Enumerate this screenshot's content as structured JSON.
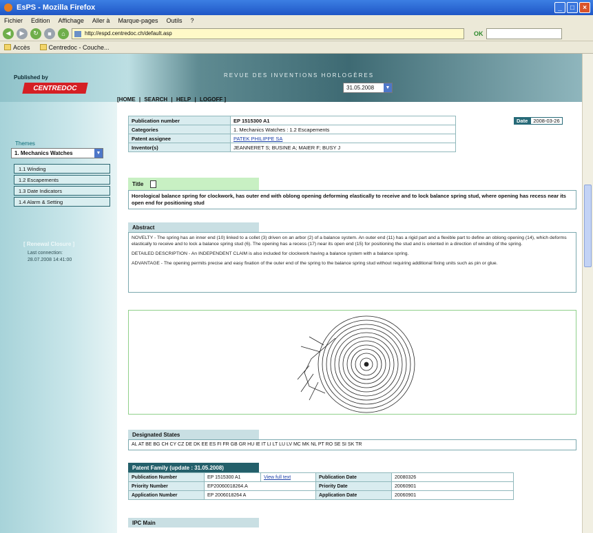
{
  "window": {
    "title": "EsPS - Mozilla Firefox",
    "menu": [
      "Fichier",
      "Edition",
      "Affichage",
      "Aller à",
      "Marque-pages",
      "Outils",
      "?"
    ],
    "url": "http://espd.centredoc.ch/default.asp",
    "bookmarks": [
      "Accès",
      "Centredoc - Couche..."
    ],
    "go_label": "OK"
  },
  "header": {
    "published_by": "Published by",
    "logo_text": "CENTREDOC",
    "review_title": "REVUE DES INVENTIONS HORLOGÈRES",
    "date_value": "31.05.2008",
    "nav": [
      "[HOME",
      "|",
      "SEARCH",
      "|",
      "HELP",
      "|",
      "LOGOFF ]"
    ]
  },
  "sidebar": {
    "theme_label": "Themes",
    "theme_value": "1. Mechanics Watches",
    "submenu": [
      "1.1 Winding",
      "1.2 Escapements",
      "1.3 Date Indicators",
      "1.4 Alarm & Setting"
    ],
    "recent_title": "[ Renewal Closure ]",
    "recent_sub": "Last connection:",
    "recent_date": "28.07.2008 14:41:00"
  },
  "record": {
    "rows": [
      {
        "key": "Publication number",
        "value": "EP 1515300 A1",
        "link": false
      },
      {
        "key": "Categories",
        "value": "1. Mechanics Watches : 1.2 Escapements",
        "link": false
      },
      {
        "key": "Patent assignee",
        "value": "PATEK PHILIPPE SA",
        "link": true
      },
      {
        "key": "Inventor(s)",
        "value": "JEANNERET S; BUSINE A; MAIER F; BUSY J",
        "link": false
      }
    ],
    "date_label": "Date",
    "date_value": "2008-03-26",
    "title_label": "Title",
    "title_text": "Horological balance spring for clockwork, has outer end with oblong opening deforming elastically to receive and to lock balance spring stud, where opening has recess near its open end for positioning stud",
    "abstract_label": "Abstract",
    "abstract": [
      "NOVELTY - The spring has an inner end (10) linked to a collet (3) driven on an arbor (2) of a balance system. An outer end (11) has a rigid part and a flexible part to define an oblong opening (14), which deforms elastically to receive and to lock a balance spring stud (6). The opening has a recess (17) near its open end (15) for positioning the stud and is oriented in a direction of winding of the spring.",
      "DETAILED DESCRIPTION - An INDEPENDENT CLAIM is also included for clockwork having a balance system with a balance spring.",
      "ADVANTAGE - The opening permits precise and easy fixation of the outer end of the spring to the balance spring stud without requiring additional fixing units such as pin or glue."
    ],
    "designated_label": "Designated States",
    "designated_states": "AL AT BE BG CH CY CZ DE DK EE ES FI FR GB GR HU IE IT LI LT LU LV MC MK NL PT RO SE SI SK TR",
    "family_label": "Patent Family (update : 31.05.2008)",
    "family": {
      "pub_number_label": "Publication Number",
      "pub_number": "EP 1515300 A1",
      "full_text_link": "View full text",
      "pub_date_label": "Publication Date",
      "pub_date": "20080326",
      "priority_number_label": "Priority Number",
      "priority_number": "EP20060018264.A",
      "priority_date_label": "Priority Date",
      "priority_date": "20060901",
      "app_number_label": "Application Number",
      "app_number": "EP 2006018264 A",
      "app_date_label": "Application Date",
      "app_date": "20060901"
    },
    "ipc_label": "IPC Main"
  }
}
